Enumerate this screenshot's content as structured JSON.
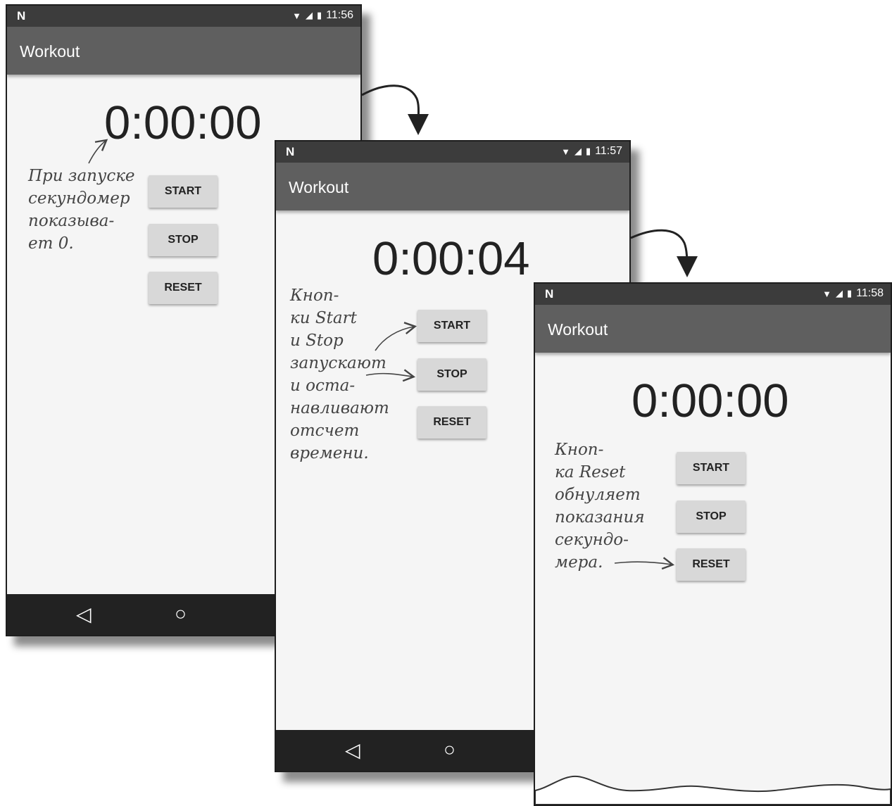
{
  "screens": [
    {
      "time": "11:56",
      "app_title": "Workout",
      "timer": "0:00:00",
      "buttons": {
        "start": "START",
        "stop": "STOP",
        "reset": "RESET"
      },
      "annotation": [
        "При запуске",
        "секундомер",
        "показыва-",
        "ет 0."
      ]
    },
    {
      "time": "11:57",
      "app_title": "Workout",
      "timer": "0:00:04",
      "buttons": {
        "start": "START",
        "stop": "STOP",
        "reset": "RESET"
      },
      "annotation": [
        "Кноп-",
        "ки Start",
        "и Stop",
        "запускают",
        "и оста-",
        "навливают",
        "отсчет",
        "времени."
      ]
    },
    {
      "time": "11:58",
      "app_title": "Workout",
      "timer": "0:00:00",
      "buttons": {
        "start": "START",
        "stop": "STOP",
        "reset": "RESET"
      },
      "annotation": [
        "Кноп-",
        "ка Reset",
        "обнуляет",
        "показания",
        "секундо-",
        "мера."
      ]
    }
  ],
  "icons": {
    "status_logo": "N",
    "wifi": "wifi-icon",
    "signal": "signal-icon",
    "battery": "battery-icon",
    "back": "back-triangle-icon",
    "home": "home-circle-icon"
  },
  "colors": {
    "status_bar": "#3c3c3c",
    "app_bar": "#5f5f5f",
    "button": "#d8d8d8",
    "nav_bar": "#222222",
    "background": "#f5f5f5"
  }
}
